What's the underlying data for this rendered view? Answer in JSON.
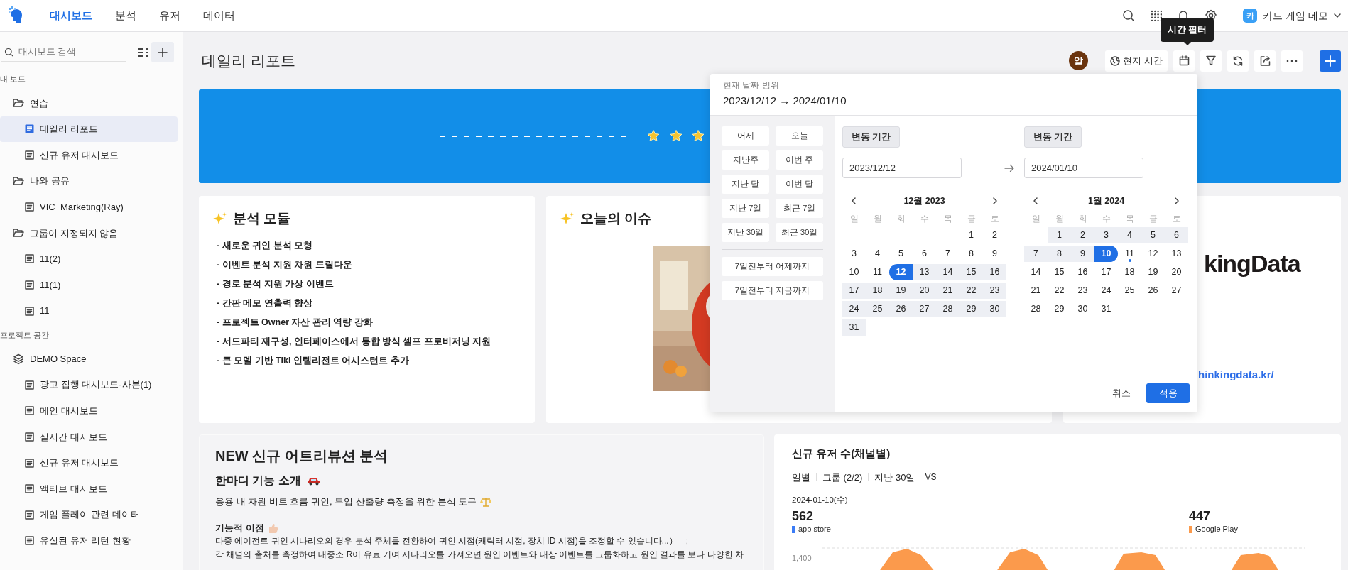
{
  "nav": {
    "tabs": [
      {
        "label": "대시보드",
        "selected": true
      },
      {
        "label": "분석",
        "selected": false
      },
      {
        "label": "유저",
        "selected": false
      },
      {
        "label": "데이터",
        "selected": false
      }
    ],
    "project": {
      "badge": "카",
      "name": "카드 게임 데모"
    }
  },
  "sidebar": {
    "search_placeholder": "대시보드 검색",
    "sections": [
      {
        "label": "내 보드",
        "items": [
          {
            "kind": "folder",
            "label": "연습",
            "selected": false,
            "children": [
              {
                "kind": "board",
                "label": "데일리 리포트",
                "selected": true
              },
              {
                "kind": "board",
                "label": "신규 유저 대시보드",
                "selected": false
              }
            ]
          },
          {
            "kind": "folder",
            "label": "나와 공유",
            "selected": false,
            "children": [
              {
                "kind": "board",
                "label": "VIC_Marketing(Ray)",
                "selected": false
              }
            ]
          },
          {
            "kind": "folder",
            "label": "그룹이 지정되지 않음",
            "selected": false,
            "children": [
              {
                "kind": "board",
                "label": "11(2)",
                "selected": false
              },
              {
                "kind": "board",
                "label": "11(1)",
                "selected": false
              },
              {
                "kind": "board",
                "label": "11",
                "selected": false
              }
            ]
          }
        ]
      },
      {
        "label": "프로젝트 공간",
        "items": [
          {
            "kind": "space",
            "label": "DEMO Space",
            "selected": false,
            "children": [
              {
                "kind": "board",
                "label": "광고 집행 대시보드-사본(1)",
                "selected": false
              },
              {
                "kind": "board",
                "label": "메인 대시보드",
                "selected": false
              },
              {
                "kind": "board",
                "label": "실시간 대시보드",
                "selected": false
              },
              {
                "kind": "board",
                "label": "신규 유저 대시보드",
                "selected": false
              },
              {
                "kind": "board",
                "label": "액티브 대시보드",
                "selected": false
              },
              {
                "kind": "board",
                "label": "게임 플레이 관련 데이터",
                "selected": false
              },
              {
                "kind": "board",
                "label": "유실된 유저 리턴 현황",
                "selected": false
              }
            ]
          }
        ]
      }
    ]
  },
  "page": {
    "title": "데일리 리포트",
    "avatar": "알",
    "tooltip": "시간 필터",
    "toolbar": [
      {
        "kind": "local_time",
        "label": "현지 시간"
      },
      {
        "kind": "calendar"
      },
      {
        "kind": "filter"
      },
      {
        "kind": "refresh"
      },
      {
        "kind": "share"
      },
      {
        "kind": "more"
      },
      {
        "kind": "add"
      }
    ]
  },
  "cards": [
    {
      "kind": "list",
      "title": "분석 모듈",
      "lines": [
        "- 새로운 귀인 분석 모형",
        "- 이벤트 분석 지원 차원 드릴다운",
        "- 경로 분석 지원 가상 이벤트",
        "- 간판 메모 연출력 향상",
        "- 프로젝트 Owner 자산 관리 역량 강화",
        "- 서드파티 재구성, 인터페이스에서 통합 방식 셀프 프로비저닝 지원",
        "- 큰 모델 기반 Tiki 인텔리전트 어시스턴트 추가"
      ]
    },
    {
      "kind": "picture",
      "title": "오늘의 이슈"
    },
    {
      "kind": "logo",
      "logo_text": "kingData",
      "link": "hinkingdata.kr/"
    }
  ],
  "attribution": {
    "title": "NEW 신규 어트리뷰션 분석",
    "subtitle": "한마디 기능 소개",
    "intro": "응용 내 자원 비트 흐름 귀인, 투입 산출량 측정을 위한 분석 도구",
    "benefit_title": "기능적 이점",
    "paragraphs": [
      "다중 에이전트 귀인 시나리오의 경우 분석 주체를 전환하여 귀인 시점(캐릭터 시점, 장치 ID 시점)을 조정할 수 있습니다...）　;",
      "각 채널의 출처를 측정하여 대중소 R이 유료 기여 시나리오를 가져오면 원인 이벤트와 대상 이벤트를 그룹화하고 원인 결과를 보다 다양한 차"
    ]
  },
  "new_users": {
    "title": "신규 유저 수(채널별)",
    "filters": [
      "일별",
      "그룹 (2/2)",
      "지난 30일"
    ],
    "compare": "VS",
    "date": "2024-01-10(수)",
    "series": [
      {
        "value": "562",
        "name": "app store",
        "color": "#3b7cf6"
      },
      {
        "value": "447",
        "name": "Google Play",
        "color": "#fb9a4c"
      }
    ],
    "axis_label": "1,400"
  },
  "date_picker": {
    "caption": "현재 날짜 범위",
    "range_text": "2023/12/12 → 2024/01/10",
    "presets": [
      "어제",
      "오늘",
      "지난주",
      "이번 주",
      "지난 달",
      "이번 달",
      "지난 7일",
      "최근 7일",
      "지난 30일",
      "최근 30일"
    ],
    "relative": [
      "7일전부터 어제까지",
      "7일전부터 지금까지"
    ],
    "ends": [
      {
        "mode": "변동 기간",
        "value": "2023/12/12"
      },
      {
        "mode": "변동 기간",
        "value": "2024/01/10"
      }
    ],
    "months": [
      {
        "title": "12월 2023",
        "weekdays": [
          "일",
          "월",
          "화",
          "수",
          "목",
          "금",
          "토"
        ],
        "weeks": [
          [
            {
              "day": "1",
              "selected": false,
              "in_range": false,
              "today": false
            },
            {
              "day": "2",
              "selected": false,
              "in_range": false,
              "today": false
            }
          ],
          [
            {
              "day": "3",
              "selected": false,
              "in_range": false,
              "today": false
            },
            {
              "day": "4",
              "selected": false,
              "in_range": false,
              "today": false
            },
            {
              "day": "5",
              "selected": false,
              "in_range": false,
              "today": false
            },
            {
              "day": "6",
              "selected": false,
              "in_range": false,
              "today": false
            },
            {
              "day": "7",
              "selected": false,
              "in_range": false,
              "today": false
            },
            {
              "day": "8",
              "selected": false,
              "in_range": false,
              "today": false
            },
            {
              "day": "9",
              "selected": false,
              "in_range": false,
              "today": false
            }
          ],
          [
            {
              "day": "10",
              "selected": false,
              "in_range": false,
              "today": false
            },
            {
              "day": "11",
              "selected": false,
              "in_range": false,
              "today": false
            },
            {
              "day": "12",
              "selected": true,
              "in_range": false,
              "today": false
            },
            {
              "day": "13",
              "selected": false,
              "in_range": true,
              "today": false
            },
            {
              "day": "14",
              "selected": false,
              "in_range": true,
              "today": false
            },
            {
              "day": "15",
              "selected": false,
              "in_range": true,
              "today": false
            },
            {
              "day": "16",
              "selected": false,
              "in_range": true,
              "today": false
            }
          ],
          [
            {
              "day": "17",
              "selected": false,
              "in_range": true,
              "today": false
            },
            {
              "day": "18",
              "selected": false,
              "in_range": true,
              "today": false
            },
            {
              "day": "19",
              "selected": false,
              "in_range": true,
              "today": false
            },
            {
              "day": "20",
              "selected": false,
              "in_range": true,
              "today": false
            },
            {
              "day": "21",
              "selected": false,
              "in_range": true,
              "today": false
            },
            {
              "day": "22",
              "selected": false,
              "in_range": true,
              "today": false
            },
            {
              "day": "23",
              "selected": false,
              "in_range": true,
              "today": false
            }
          ],
          [
            {
              "day": "24",
              "selected": false,
              "in_range": true,
              "today": false
            },
            {
              "day": "25",
              "selected": false,
              "in_range": true,
              "today": false
            },
            {
              "day": "26",
              "selected": false,
              "in_range": true,
              "today": false
            },
            {
              "day": "27",
              "selected": false,
              "in_range": true,
              "today": false
            },
            {
              "day": "28",
              "selected": false,
              "in_range": true,
              "today": false
            },
            {
              "day": "29",
              "selected": false,
              "in_range": true,
              "today": false
            },
            {
              "day": "30",
              "selected": false,
              "in_range": true,
              "today": false
            }
          ],
          [
            {
              "day": "31",
              "selected": false,
              "in_range": true,
              "today": false
            }
          ]
        ]
      },
      {
        "title": "1월 2024",
        "weekdays": [
          "일",
          "월",
          "화",
          "수",
          "목",
          "금",
          "토"
        ],
        "weeks": [
          [
            {
              "day": "1",
              "selected": false,
              "in_range": true,
              "today": false
            },
            {
              "day": "2",
              "selected": false,
              "in_range": true,
              "today": false
            },
            {
              "day": "3",
              "selected": false,
              "in_range": true,
              "today": false
            },
            {
              "day": "4",
              "selected": false,
              "in_range": true,
              "today": false
            },
            {
              "day": "5",
              "selected": false,
              "in_range": true,
              "today": false
            },
            {
              "day": "6",
              "selected": false,
              "in_range": true,
              "today": false
            }
          ],
          [
            {
              "day": "7",
              "selected": false,
              "in_range": true,
              "today": false
            },
            {
              "day": "8",
              "selected": false,
              "in_range": true,
              "today": false
            },
            {
              "day": "9",
              "selected": false,
              "in_range": true,
              "today": false
            },
            {
              "day": "10",
              "selected": true,
              "in_range": false,
              "today": false
            },
            {
              "day": "11",
              "selected": false,
              "in_range": false,
              "today": true
            },
            {
              "day": "12",
              "selected": false,
              "in_range": false,
              "today": false
            },
            {
              "day": "13",
              "selected": false,
              "in_range": false,
              "today": false
            }
          ],
          [
            {
              "day": "14",
              "selected": false,
              "in_range": false,
              "today": false
            },
            {
              "day": "15",
              "selected": false,
              "in_range": false,
              "today": false
            },
            {
              "day": "16",
              "selected": false,
              "in_range": false,
              "today": false
            },
            {
              "day": "17",
              "selected": false,
              "in_range": false,
              "today": false
            },
            {
              "day": "18",
              "selected": false,
              "in_range": false,
              "today": false
            },
            {
              "day": "19",
              "selected": false,
              "in_range": false,
              "today": false
            },
            {
              "day": "20",
              "selected": false,
              "in_range": false,
              "today": false
            }
          ],
          [
            {
              "day": "21",
              "selected": false,
              "in_range": false,
              "today": false
            },
            {
              "day": "22",
              "selected": false,
              "in_range": false,
              "today": false
            },
            {
              "day": "23",
              "selected": false,
              "in_range": false,
              "today": false
            },
            {
              "day": "24",
              "selected": false,
              "in_range": false,
              "today": false
            },
            {
              "day": "25",
              "selected": false,
              "in_range": false,
              "today": false
            },
            {
              "day": "26",
              "selected": false,
              "in_range": false,
              "today": false
            },
            {
              "day": "27",
              "selected": false,
              "in_range": false,
              "today": false
            }
          ],
          [
            {
              "day": "28",
              "selected": false,
              "in_range": false,
              "today": false
            },
            {
              "day": "29",
              "selected": false,
              "in_range": false,
              "today": false
            },
            {
              "day": "30",
              "selected": false,
              "in_range": false,
              "today": false
            },
            {
              "day": "31",
              "selected": false,
              "in_range": false,
              "today": false
            }
          ]
        ]
      }
    ],
    "cancel": "취소",
    "apply": "적용"
  }
}
